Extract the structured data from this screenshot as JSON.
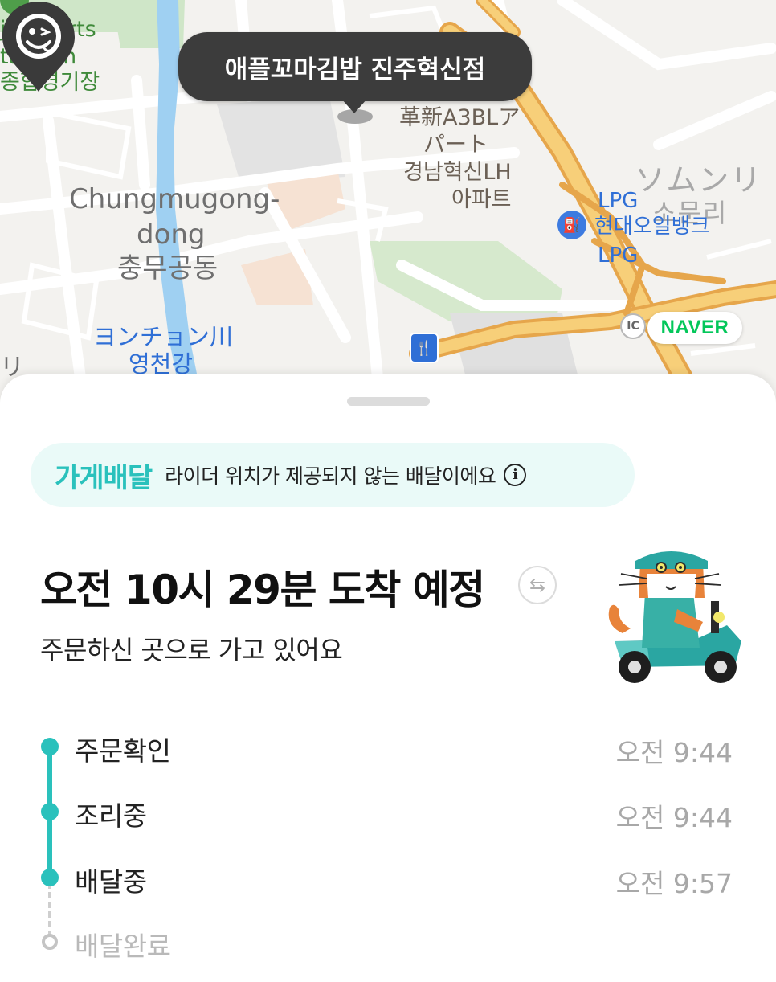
{
  "map": {
    "store_bubble": "애플꼬마김밥 진주혁신점",
    "labels": {
      "stadium_en_1": "ju Sports",
      "stadium_en_2": "tadium",
      "stadium_ko": "종합경기장",
      "apt_jp_1": "革新A3BLア",
      "apt_jp_2": "パート",
      "apt_ko_1": "경남혁신LH",
      "apt_ko_2": "아파트",
      "chungmu_en_1": "Chungmugong-",
      "chungmu_en_2": "dong",
      "chungmu_ko": "충무공동",
      "river_jp": "ヨンチョン川",
      "river_ko": "영천강",
      "somun_jp": "ソムンリ",
      "somun_ko": "소문리",
      "lpg_top": "LPG",
      "gas_station": "현대오일뱅크",
      "lpg_bottom": "LPG",
      "ic": "IC",
      "left_edge": "リ"
    },
    "naver_badge": "NAVER"
  },
  "sheet": {
    "store_delivery_brand": "가게배달",
    "store_delivery_text": "라이더 위치가 제공되지 않는 배달이에요",
    "info_icon": "i",
    "eta_title": "오전 10시 29분 도착 예정",
    "eta_subtitle": "주문하신 곳으로 가고 있어요",
    "swap_icon": "⇆"
  },
  "timeline": [
    {
      "label": "주문확인",
      "time": "오전 9:44",
      "status": "done"
    },
    {
      "label": "조리중",
      "time": "오전 9:44",
      "status": "done"
    },
    {
      "label": "배달중",
      "time": "오전 9:57",
      "status": "done"
    },
    {
      "label": "배달완료",
      "time": "",
      "status": "pending"
    }
  ],
  "colors": {
    "accent": "#2ac1bc",
    "naver_green": "#03c75a",
    "map_road_orange": "#f5c16c",
    "bubble_dark": "#3c3c3c"
  },
  "icons": {
    "rider_pin": "smiley-face-pin-icon",
    "gas": "gas-station-icon",
    "restaurant": "restaurant-icon",
    "mascot": "cat-rider-scooter-illustration"
  }
}
